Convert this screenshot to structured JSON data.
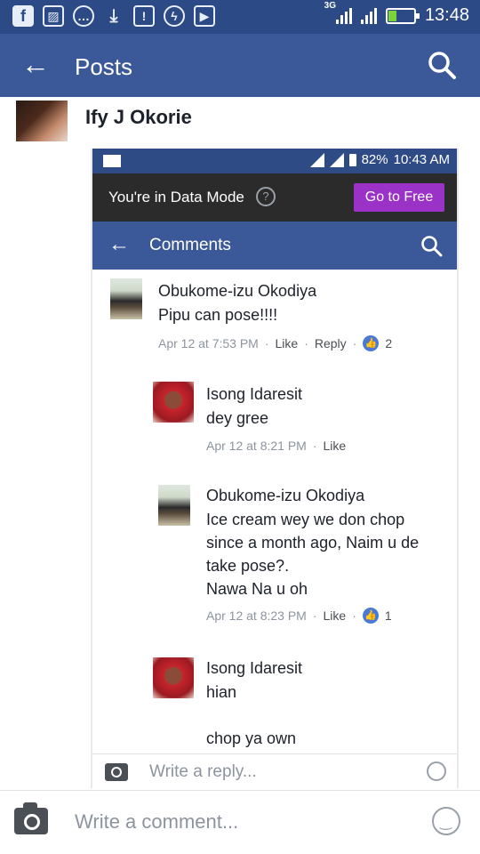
{
  "status_bar": {
    "network_tag": "3G",
    "time": "13:48",
    "icons": [
      "facebook-icon",
      "gallery-icon",
      "chat-icon",
      "download-icon",
      "alert-icon",
      "messenger-icon",
      "youtube-icon"
    ]
  },
  "app_bar": {
    "title": "Posts"
  },
  "post": {
    "author_name": "Ify J Okorie"
  },
  "embedded_screenshot": {
    "status_bar": {
      "battery": "82%",
      "time": "10:43 AM"
    },
    "data_mode_banner": {
      "text": "You're in Data Mode",
      "help_glyph": "?",
      "button_label": "Go to Free"
    },
    "app_bar": {
      "title": "Comments"
    },
    "comments": [
      {
        "name": "Obukome-izu Okodiya",
        "text": "Pipu can pose!!!!",
        "time": "Apr 12 at 7:53 PM",
        "like_label": "Like",
        "reply_label": "Reply",
        "reactions": "2"
      },
      {
        "name": "Isong Idaresit",
        "text": "dey gree",
        "time": "Apr 12 at 8:21 PM",
        "like_label": "Like"
      },
      {
        "name": "Obukome-izu Okodiya",
        "text": "Ice cream wey we don chop\nsince a month ago, Naim u de\ntake pose?.\nNawa Na u oh",
        "time": "Apr 12 at 8:23 PM",
        "like_label": "Like",
        "reactions": "1"
      },
      {
        "name": "Isong Idaresit",
        "text": "hian\n\nchop ya own"
      }
    ],
    "reply_placeholder": "Write a reply..."
  },
  "composer": {
    "placeholder": "Write a comment..."
  },
  "colors": {
    "status_bar": "#2c4a85",
    "app_bar": "#3b5998",
    "go_to_free": "#9b32c8",
    "like_badge": "#4a7ad8"
  }
}
